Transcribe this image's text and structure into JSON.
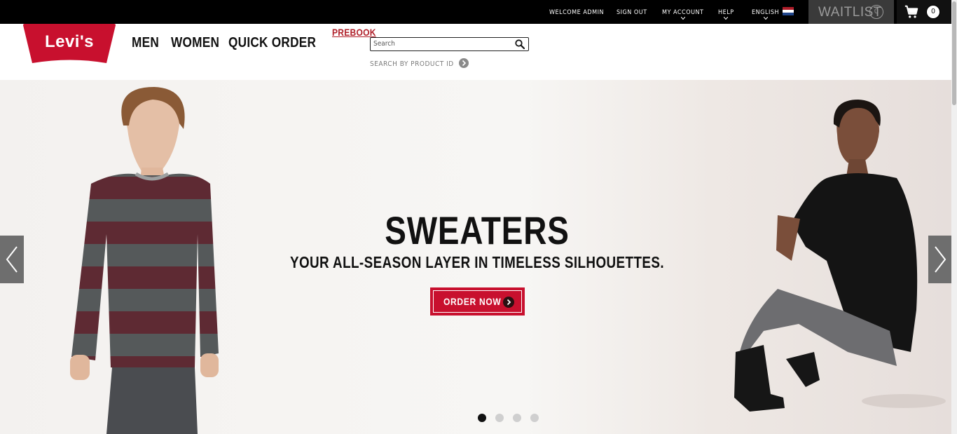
{
  "topbar": {
    "welcome": "WELCOME ADMIN",
    "signout": "SIGN OUT",
    "my_account": "MY ACCOUNT",
    "help": "HELP",
    "language": "ENGLISH",
    "waitlist_label": "WAITLIST",
    "waitlist_count": "0",
    "cart_count": "0"
  },
  "header": {
    "logo_text": "Levi's",
    "nav": [
      "MEN",
      "WOMEN",
      "QUICK ORDER"
    ],
    "prebook": "PREBOOK",
    "search_placeholder": "Search",
    "search_by_id": "SEARCH BY PRODUCT ID"
  },
  "hero": {
    "title": "SWEATERS",
    "subtitle": "YOUR ALL-SEASON LAYER IN TIMELESS SILHOUETTES.",
    "cta": "ORDER NOW",
    "active_slide": 1,
    "slide_count": 4
  },
  "colors": {
    "brand_red": "#c8102e",
    "prebook_red": "#b0202a",
    "topbar": "#000000"
  }
}
